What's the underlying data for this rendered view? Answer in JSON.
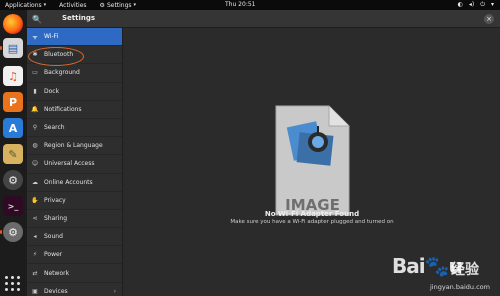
{
  "topbar": {
    "applications": "Applications",
    "activities": "Activities",
    "settings": "Settings",
    "clock": "Thu 20:51"
  },
  "header": {
    "title": "Settings"
  },
  "sidebar": {
    "items": [
      {
        "label": "Wi-Fi",
        "icon": "wifi-icon",
        "selected": true
      },
      {
        "label": "Bluetooth",
        "icon": "bluetooth-icon"
      },
      {
        "label": "Background",
        "icon": "background-icon"
      },
      {
        "label": "Dock",
        "icon": "dock-icon"
      },
      {
        "label": "Notifications",
        "icon": "bell-icon"
      },
      {
        "label": "Search",
        "icon": "search-icon"
      },
      {
        "label": "Region & Language",
        "icon": "globe-icon"
      },
      {
        "label": "Universal Access",
        "icon": "accessibility-icon"
      },
      {
        "label": "Online Accounts",
        "icon": "cloud-icon"
      },
      {
        "label": "Privacy",
        "icon": "hand-icon"
      },
      {
        "label": "Sharing",
        "icon": "share-icon"
      },
      {
        "label": "Sound",
        "icon": "speaker-icon"
      },
      {
        "label": "Power",
        "icon": "power-icon"
      },
      {
        "label": "Network",
        "icon": "network-icon"
      },
      {
        "label": "Devices",
        "icon": "devices-icon"
      }
    ]
  },
  "content": {
    "placeholder_text": "IMAGE",
    "title": "No Wi-Fi Adapter Found",
    "subtitle": "Make sure you have a Wi-Fi adapter plugged and turned on"
  },
  "dock": {
    "apps": [
      "firefox",
      "files",
      "rhythmbox",
      "libreoffice-impress",
      "software-center",
      "text-editor",
      "settings",
      "terminal",
      "system-settings"
    ],
    "show_apps_label": "Show Applications"
  },
  "watermark": {
    "brand": "Bai",
    "brand_end": "u",
    "cn": "经验",
    "url": "jingyan.baidu.com"
  },
  "colors": {
    "selected": "#2e6ac4",
    "highlight": "#e06a2a",
    "ubuntu_orange": "#e95420"
  }
}
